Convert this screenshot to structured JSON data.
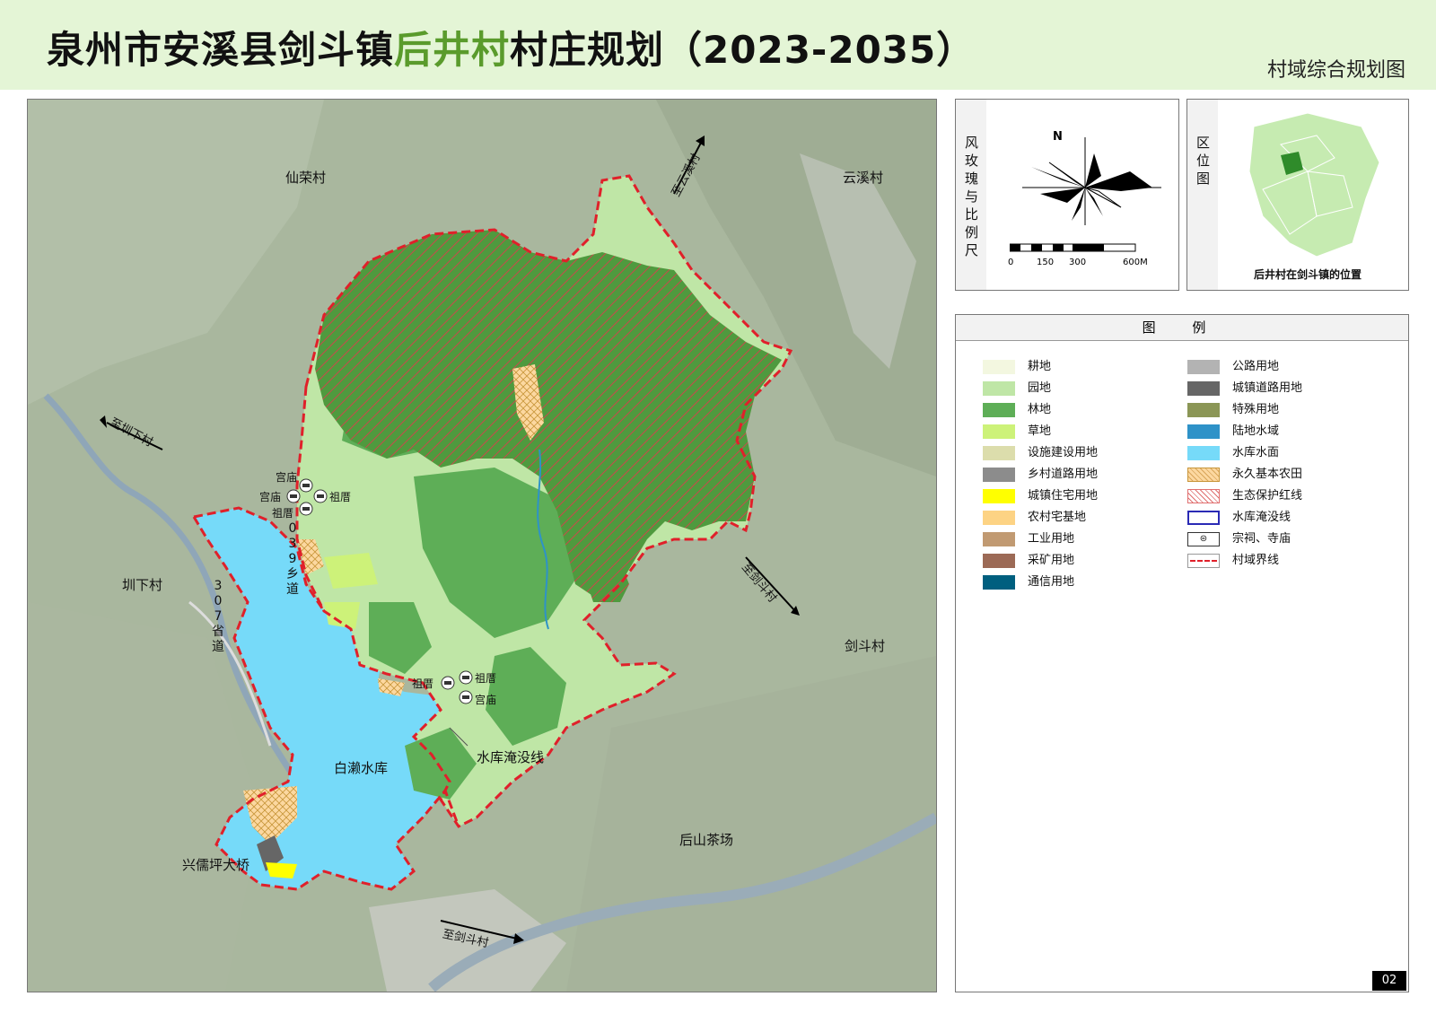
{
  "header": {
    "title_pre": "泉州市安溪县剑斗镇",
    "title_highlight": "后井村",
    "title_post": "村庄规划（2023-2035）",
    "subtitle": "村域综合规划图"
  },
  "map": {
    "neighbor_villages": [
      "仙荣村",
      "云溪村",
      "圳下村",
      "剑斗村",
      "后山茶场"
    ],
    "reservoir": "白濑水库",
    "bridge": "兴儒坪大桥",
    "flood_line_label": "水库淹没线",
    "directions": [
      "至云溪村",
      "至圳下村",
      "至剑斗村",
      "至剑斗村"
    ],
    "road_309": [
      "0",
      "3",
      "9",
      "乡",
      "道"
    ],
    "road_307": [
      "3",
      "0",
      "7",
      "省",
      "道"
    ],
    "temple_labels": [
      "宫庙",
      "宫庙",
      "祖厝",
      "祖厝",
      "祖厝",
      "祖厝",
      "宫庙"
    ]
  },
  "compass": {
    "title": "风玫瑰与比例尺",
    "north": "N",
    "scale_labels": [
      "0",
      "150",
      "300",
      "600M"
    ]
  },
  "location": {
    "title": "区位图",
    "caption": "后井村在剑斗镇的位置"
  },
  "legend": {
    "title": "图 例",
    "items": [
      {
        "label": "耕地",
        "color": "#f3f7e0"
      },
      {
        "label": "园地",
        "color": "#bfe6a6"
      },
      {
        "label": "林地",
        "color": "#5eae57"
      },
      {
        "label": "草地",
        "color": "#cdf279"
      },
      {
        "label": "设施建设用地",
        "color": "#dcddac"
      },
      {
        "label": "乡村道路用地",
        "color": "#8c8c8c"
      },
      {
        "label": "城镇住宅用地",
        "color": "#ffff00"
      },
      {
        "label": "农村宅基地",
        "color": "#fdd384"
      },
      {
        "label": "工业用地",
        "color": "#c19a72"
      },
      {
        "label": "采矿用地",
        "color": "#9c6a56"
      },
      {
        "label": "通信用地",
        "color": "#005f7f"
      },
      {
        "label": "公路用地",
        "color": "#b3b3b3"
      },
      {
        "label": "城镇道路用地",
        "color": "#666666"
      },
      {
        "label": "特殊用地",
        "color": "#8b9656"
      },
      {
        "label": "陆地水域",
        "color": "#2e92c8"
      },
      {
        "label": "水库水面",
        "color": "#76daf9"
      },
      {
        "label": "永久基本农田",
        "color": "#fcd8a0"
      },
      {
        "label": "生态保护红线",
        "color": "#f2c4c4"
      },
      {
        "label": "水库淹没线",
        "color": "#2a2ab5"
      },
      {
        "label": "宗祠、寺庙",
        "color": "#333333"
      },
      {
        "label": "村域界线",
        "color": "#e0202a"
      }
    ]
  },
  "page_number": "02"
}
